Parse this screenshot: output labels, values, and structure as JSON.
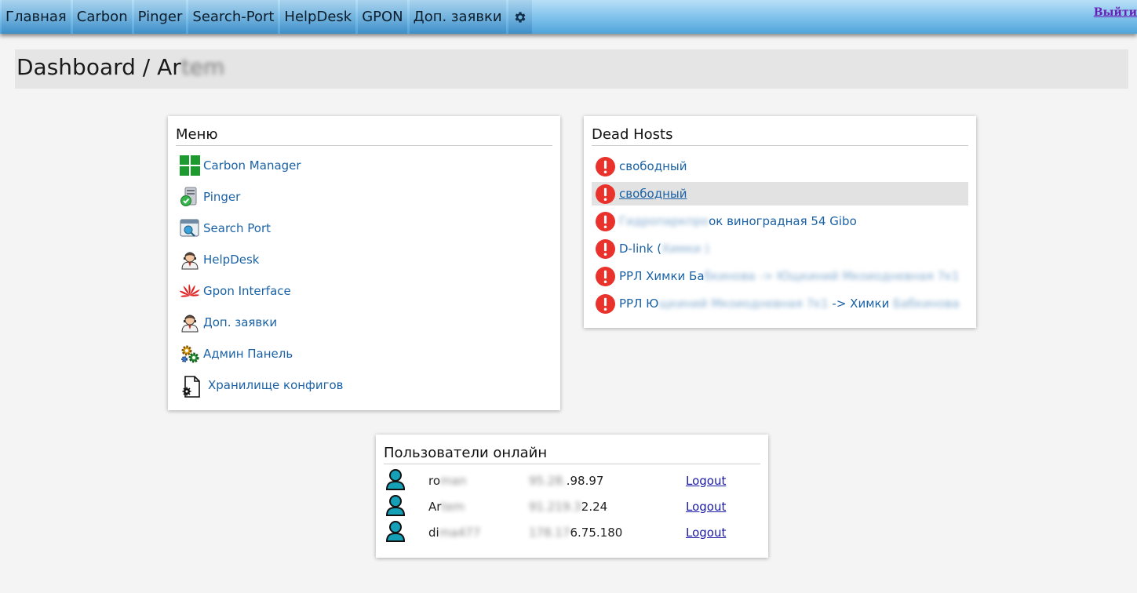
{
  "nav": {
    "items": [
      "Главная",
      "Carbon",
      "Pinger",
      "Search-Port",
      "HelpDesk",
      "GPON",
      "Доп. заявки"
    ],
    "logout_label": "Выйти"
  },
  "header": {
    "title_prefix": "Dashboard / Ar",
    "title_blurred": "tem"
  },
  "menu": {
    "title": "Меню",
    "items": [
      {
        "label": "Carbon Manager",
        "icon": "carbon-grid-icon"
      },
      {
        "label": "Pinger",
        "icon": "pinger-server-icon"
      },
      {
        "label": "Search Port",
        "icon": "search-port-icon"
      },
      {
        "label": "HelpDesk",
        "icon": "helpdesk-agent-icon"
      },
      {
        "label": "Gpon Interface",
        "icon": "huawei-logo-icon"
      },
      {
        "label": "Доп. заявки",
        "icon": "requests-agent-icon"
      },
      {
        "label": "Админ Панель",
        "icon": "admin-gears-icon"
      },
      {
        "label": "Хранилище конфигов",
        "icon": "config-file-icon"
      }
    ]
  },
  "dead_hosts": {
    "title": "Dead Hosts",
    "items": [
      {
        "prefix": "свободный",
        "blur1": "",
        "mid": "",
        "blur2": ""
      },
      {
        "prefix": "свободный",
        "blur1": "",
        "mid": "",
        "blur2": ""
      },
      {
        "prefix": "",
        "blur1": "Гидропаркпро",
        "mid": "ок виноградная 54 Gibo",
        "blur2": ""
      },
      {
        "prefix": "D-link (",
        "blur1": "Химки )",
        "mid": "",
        "blur2": ""
      },
      {
        "prefix": "РРЛ Химки Ба",
        "blur1": "бкинова -> Ющкиний Мкоиодневная 7к1",
        "mid": "",
        "blur2": ""
      },
      {
        "prefix": "РРЛ Ю",
        "blur1": "щкиний Мкоиодневная 7к1",
        "mid": " -> Химки ",
        "blur2": "Бабкинова"
      }
    ]
  },
  "users": {
    "title": "Пользователи онлайн",
    "rows": [
      {
        "name_visible": "ro",
        "name_blur": "man",
        "ip_blur": "95.28.",
        "ip_visible": ".98.97",
        "logout": "Logout"
      },
      {
        "name_visible": "Ar",
        "name_blur": "tem",
        "ip_blur": "91.219.3",
        "ip_visible": "2.24",
        "logout": "Logout"
      },
      {
        "name_visible": "di",
        "name_blur": "ma477",
        "ip_blur": "178.17",
        "ip_visible": "6.75.180",
        "logout": "Logout"
      }
    ]
  },
  "colors": {
    "link": "#1a62a5",
    "alert": "#e8322b",
    "user_icon": "#16a0b8",
    "nav_logout": "#6a1fb5"
  }
}
